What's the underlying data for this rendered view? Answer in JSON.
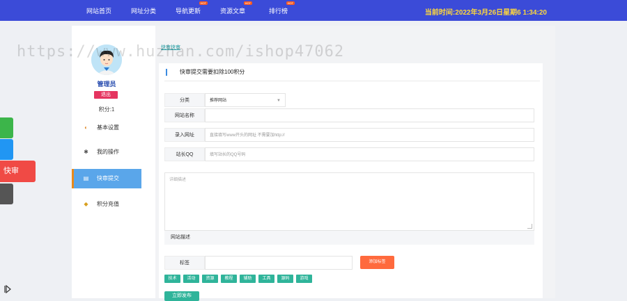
{
  "nav": {
    "items": [
      {
        "label": "网站首页",
        "hot": false
      },
      {
        "label": "网址分类",
        "hot": false
      },
      {
        "label": "导航更新",
        "hot": true
      },
      {
        "label": "资源文章",
        "hot": true
      },
      {
        "label": "排行榜",
        "hot": true
      }
    ],
    "hot_label": "HOT",
    "clock": "当前时间:2022年3月26日星期6 1:34:20"
  },
  "user": {
    "name": "管理员",
    "logout": "退出",
    "points": "积分:1"
  },
  "menu": [
    {
      "label": "基本设置",
      "icon": "gear-icon",
      "glyph": "◐"
    },
    {
      "label": "我的操作",
      "icon": "settings-icon",
      "glyph": "✱"
    },
    {
      "label": "快审提交",
      "icon": "document-icon",
      "glyph": "▤"
    },
    {
      "label": "积分充值",
      "icon": "coins-icon",
      "glyph": "◆"
    }
  ],
  "panel_tab": "快审快审",
  "form": {
    "header": "快审提交需要扣除100积分",
    "category_label": "分类",
    "category_value": "推荐网站",
    "site_name_label": "网站名称",
    "site_name_placeholder": "",
    "url_label": "录入网址",
    "url_placeholder": "直接填写www开头的网址 不需要加http://",
    "qq_label": "站长QQ",
    "qq_placeholder": "填写站长的QQ号码",
    "detail_placeholder": "详细描述",
    "desc_label": "网站描述",
    "tag_label": "标签",
    "add_tag": "添加标签",
    "tags": [
      "技术",
      "活动",
      "资源",
      "教程",
      "辅助",
      "工具",
      "源码",
      "游戏"
    ],
    "submit": "立即发布"
  },
  "float": {
    "kuaishen": "快审"
  },
  "watermark": "https://www.huzhan.com/ishop47062",
  "colors": {
    "topbar": "#3b4bd8",
    "clock": "#ffd83a",
    "active_menu": "#5aa6ea",
    "tag": "#2fb49a",
    "add_tag": "#ff6a3d",
    "logout": "#e53560"
  }
}
